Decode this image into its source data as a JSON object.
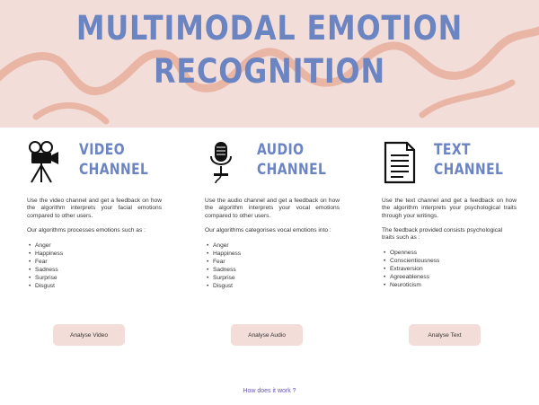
{
  "header": {
    "title": "Multimodal Emotion Recognition"
  },
  "columns": [
    {
      "icon": "movie-camera-icon",
      "title": "Video Channel",
      "description": "Use the video channel and get a feedback on how the algorithm interprets your facial emotions compared to other users.",
      "subheading": "Our algorithms processes emotions such as :",
      "items": [
        "Anger",
        "Happiness",
        "Fear",
        "Sadness",
        "Surprise",
        "Disgust"
      ],
      "button": "Analyse Video"
    },
    {
      "icon": "microphone-icon",
      "title": "Audio Channel",
      "description": "Use the audio channel and get a feedback on how the algorithm interprets your vocal emotions compared to other users.",
      "subheading": "Our algorithms categorises vocal emotions into :",
      "items": [
        "Anger",
        "Happiness",
        "Fear",
        "Sadness",
        "Surprise",
        "Disgust"
      ],
      "button": "Analyse Audio"
    },
    {
      "icon": "document-icon",
      "title": "Text Channel",
      "description": "Use the text channel and get a feedback on how the algorithm interprets your psychological traits through your writings.",
      "subheading": "The feedback provided consists psychological traits such as :",
      "items": [
        "Openness",
        "Conscientiousness",
        "Extraversion",
        "Agreeableness",
        "Neuroticism"
      ],
      "button": "Analyse Text"
    }
  ],
  "footer": {
    "link": "How does it work ?"
  },
  "colors": {
    "hero_bg": "#f3ddd9",
    "squiggle": "#e9b6a6",
    "accent": "#6b84c2",
    "button_bg": "#f3ddd9",
    "link": "#6a55b8"
  }
}
